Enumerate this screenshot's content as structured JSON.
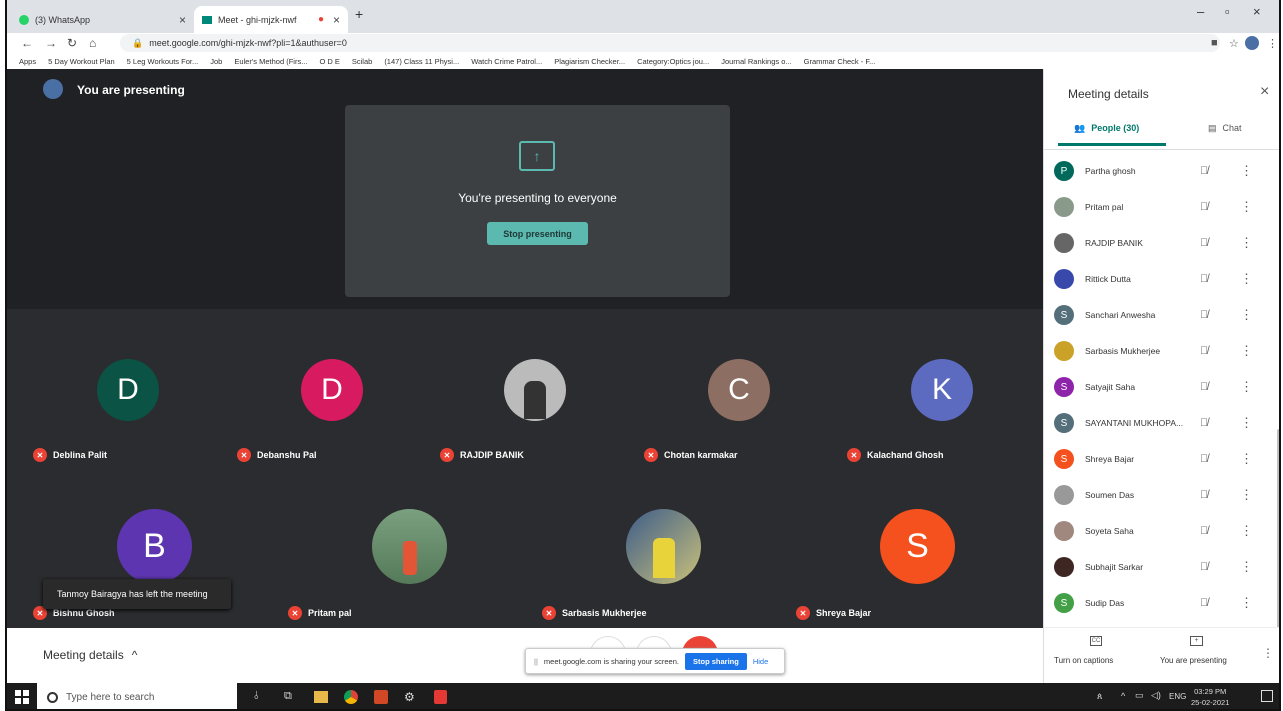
{
  "tabs": [
    {
      "title": "(3) WhatsApp"
    },
    {
      "title": "Meet - ghi-mjzk-nwf"
    }
  ],
  "address": {
    "url": "meet.google.com/ghi-mjzk-nwf?pli=1&authuser=0"
  },
  "bookmarks": [
    "Apps",
    "5 Day Workout Plan",
    "5 Leg Workouts For...",
    "Job",
    "Euler's Method (Firs...",
    "O D E",
    "Scilab",
    "(147) Class 11 Physi...",
    "Watch Crime Patrol...",
    "Plagiarism Checker...",
    "Category:Optics jou...",
    "Journal Rankings o...",
    "Grammar Check - F..."
  ],
  "presenting": {
    "banner": "You are presenting",
    "message": "You're presenting to everyone",
    "stop_button": "Stop presenting"
  },
  "tiles": [
    {
      "name": "Deblina Palit",
      "initial": "D",
      "color": "#0b5345"
    },
    {
      "name": "Debanshu Pal",
      "initial": "D",
      "color": "#d81b60"
    },
    {
      "name": "RAJDIP BANIK",
      "initial": "",
      "color": "#bbbbbb"
    },
    {
      "name": "Chotan karmakar",
      "initial": "C",
      "color": "#8d6e63"
    },
    {
      "name": "Kalachand Ghosh",
      "initial": "K",
      "color": "#5c6bc0"
    },
    {
      "name": "Bishnu Ghosh",
      "initial": "B",
      "color": "#5e35b1"
    },
    {
      "name": "Pritam pal",
      "initial": "",
      "color": "#6d8f5a"
    },
    {
      "name": "Sarbasis Mukherjee",
      "initial": "",
      "color": "#b8a030"
    },
    {
      "name": "Shreya Bajar",
      "initial": "S",
      "color": "#f4511e"
    }
  ],
  "toast": "Tanmoy Bairagya has left the meeting",
  "bottom": {
    "meeting_details": "Meeting details",
    "share_notice": "meet.google.com is sharing your screen.",
    "stop_sharing": "Stop sharing",
    "hide": "Hide"
  },
  "side": {
    "title": "Meeting details",
    "tab_people": "People (30)",
    "tab_chat": "Chat",
    "people": [
      {
        "name": "Partha ghosh",
        "initial": "P",
        "color": "#00695c"
      },
      {
        "name": "Pritam pal",
        "initial": "",
        "color": "#8a9a8a"
      },
      {
        "name": "RAJDIP BANIK",
        "initial": "",
        "color": "#666666"
      },
      {
        "name": "Rittick Dutta",
        "initial": "",
        "color": "#3949ab"
      },
      {
        "name": "Sanchari Anwesha",
        "initial": "S",
        "color": "#546e7a"
      },
      {
        "name": "Sarbasis Mukherjee",
        "initial": "",
        "color": "#c9a227"
      },
      {
        "name": "Satyajit Saha",
        "initial": "S",
        "color": "#8e24aa"
      },
      {
        "name": "SAYANTANI MUKHOPA...",
        "initial": "S",
        "color": "#546e7a"
      },
      {
        "name": "Shreya Bajar",
        "initial": "S",
        "color": "#f4511e"
      },
      {
        "name": "Soumen Das",
        "initial": "",
        "color": "#999999"
      },
      {
        "name": "Soyeta Saha",
        "initial": "",
        "color": "#a1887f"
      },
      {
        "name": "Subhajit Sarkar",
        "initial": "",
        "color": "#3e2723"
      },
      {
        "name": "Sudip Das",
        "initial": "S",
        "color": "#43a047"
      }
    ],
    "captions": "Turn on captions",
    "you_presenting": "You are presenting"
  },
  "taskbar": {
    "search": "Type here to search",
    "lang": "ENG",
    "time": "03:29 PM",
    "date": "25-02-2021"
  }
}
